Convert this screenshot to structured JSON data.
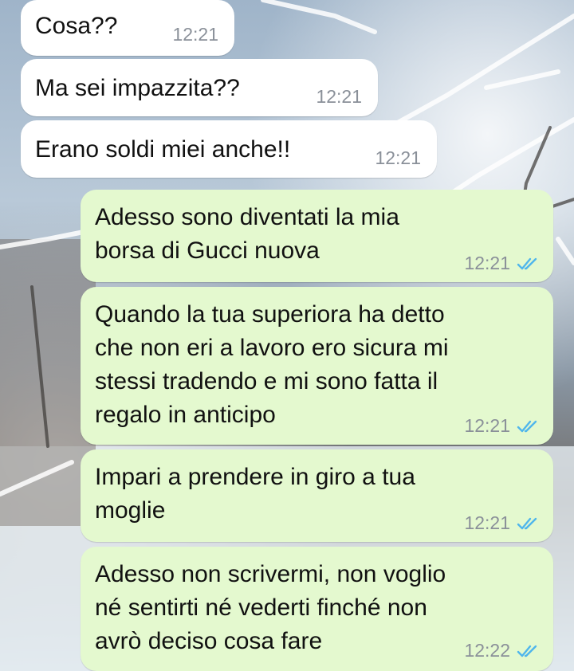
{
  "messages": [
    {
      "direction": "incoming",
      "text": "Cosa??",
      "time": "12:21"
    },
    {
      "direction": "incoming",
      "text": "Ma sei impazzita??",
      "time": "12:21"
    },
    {
      "direction": "incoming",
      "text": "Erano soldi miei anche!!",
      "time": "12:21"
    },
    {
      "direction": "outgoing",
      "text": "Adesso sono diventati la mia\nborsa di Gucci nuova",
      "time": "12:21",
      "status_icon": "double-check-read-icon"
    },
    {
      "direction": "outgoing",
      "text": "Quando la tua superiora ha detto\nche non eri a lavoro ero sicura mi\nstessi tradendo e mi sono fatta il\nregalo in anticipo",
      "time": "12:21",
      "status_icon": "double-check-read-icon"
    },
    {
      "direction": "outgoing",
      "text": "Impari a prendere in giro a tua\nmoglie",
      "time": "12:21",
      "status_icon": "double-check-read-icon"
    },
    {
      "direction": "outgoing",
      "text": "Adesso non scrivermi, non voglio\nné sentirti né vederti finché non\navrò deciso cosa fare",
      "time": "12:22",
      "status_icon": "double-check-read-icon"
    }
  ],
  "colors": {
    "incoming_bubble": "#ffffff",
    "outgoing_bubble": "#e4f9cf",
    "read_ticks": "#4fb6ec",
    "timestamp": "#8a9099"
  },
  "background": "snowy-branches-wallpaper"
}
